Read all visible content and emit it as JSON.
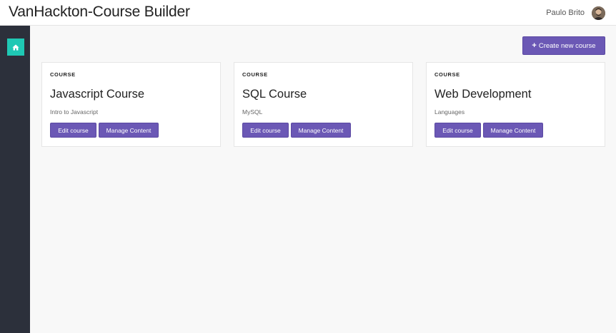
{
  "header": {
    "title": "VanHackton-Course Builder",
    "user_name": "Paulo Brito",
    "avatar_icon": "user-avatar"
  },
  "sidebar": {
    "home_icon": "home-icon",
    "accent_color": "#1fc8b4"
  },
  "toolbar": {
    "create_label": "Create new course",
    "create_icon": "plus-icon"
  },
  "courses": [
    {
      "eyebrow": "COURSE",
      "title": "Javascript Course",
      "subtitle": "Intro to Javascript",
      "edit_label": "Edit course",
      "manage_label": "Manage Content"
    },
    {
      "eyebrow": "COURSE",
      "title": "SQL Course",
      "subtitle": "MySQL",
      "edit_label": "Edit course",
      "manage_label": "Manage Content"
    },
    {
      "eyebrow": "COURSE",
      "title": "Web Development",
      "subtitle": "Languages",
      "edit_label": "Edit course",
      "manage_label": "Manage Content"
    }
  ],
  "colors": {
    "primary_button": "#6b58b5",
    "sidebar_bg": "#2c303b",
    "page_bg": "#f8f8f8"
  }
}
